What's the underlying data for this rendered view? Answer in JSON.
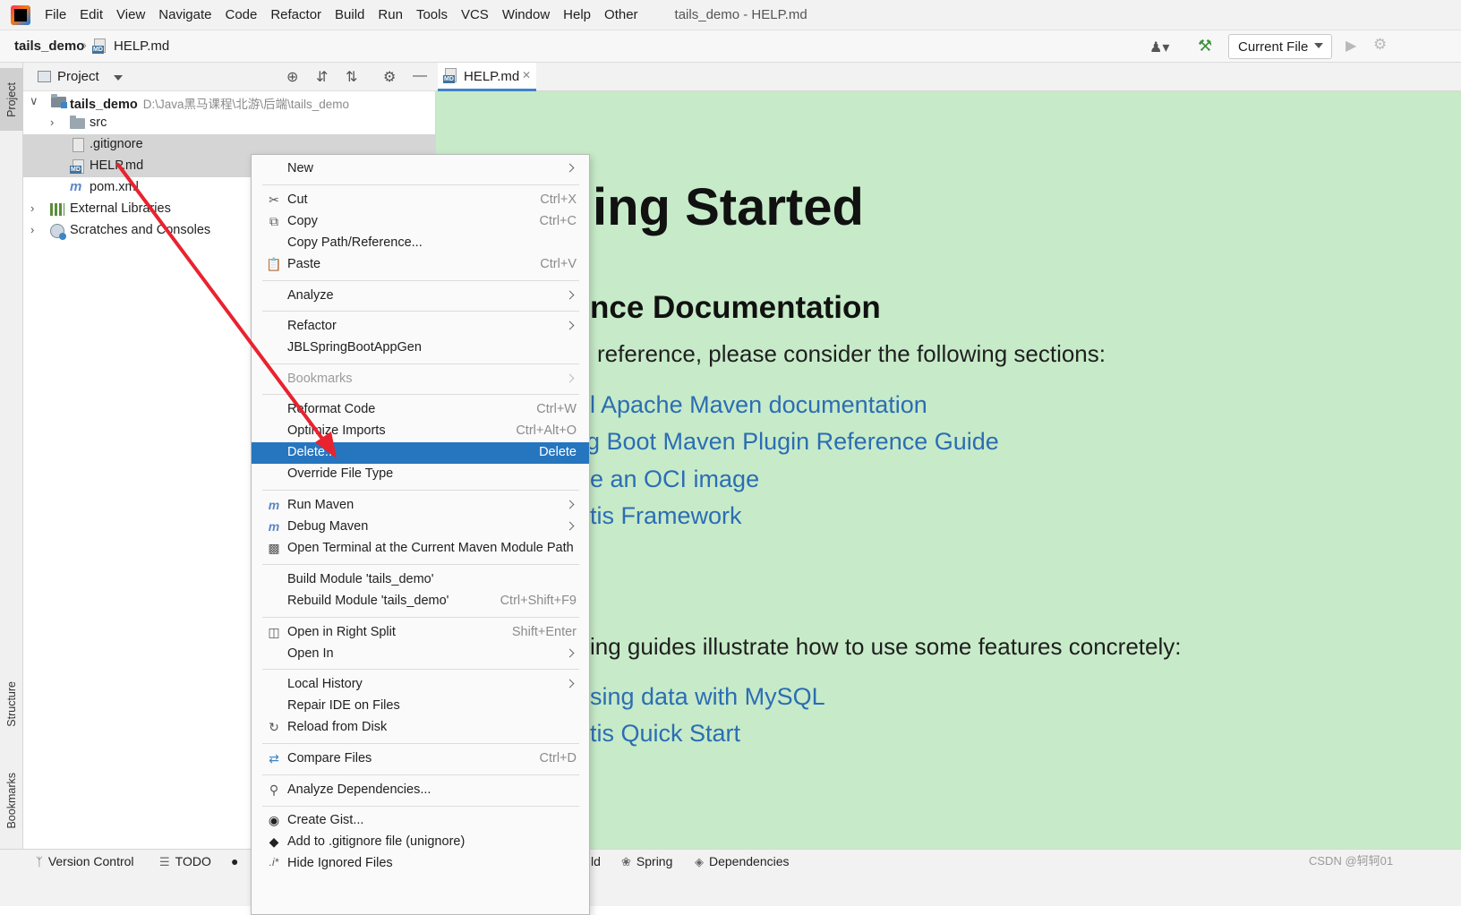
{
  "menubar": {
    "items": [
      "File",
      "Edit",
      "View",
      "Navigate",
      "Code",
      "Refactor",
      "Build",
      "Run",
      "Tools",
      "VCS",
      "Window",
      "Help",
      "Other"
    ],
    "window_title": "tails_demo - HELP.md"
  },
  "navbar": {
    "project": "tails_demo",
    "file": "HELP.md",
    "run_config": "Current File"
  },
  "left_strip": {
    "project_tab": "Project",
    "structure_tab": "Structure",
    "bookmarks_tab": "Bookmarks"
  },
  "project_panel": {
    "title": "Project",
    "tree": [
      {
        "label": "tails_demo",
        "path": "D:\\Java黑马课程\\北游\\后端\\tails_demo"
      },
      {
        "label": "src"
      },
      {
        "label": ".gitignore"
      },
      {
        "label": "HELP.md"
      },
      {
        "label": "pom.xml"
      },
      {
        "label": "External Libraries"
      },
      {
        "label": "Scratches and Consoles"
      }
    ]
  },
  "editor": {
    "tab": "HELP.md",
    "md_badge": "MD",
    "content": {
      "h1": "ing Started",
      "h2_ref": "nce Documentation",
      "p_ref": "reference, please consider the following sections:",
      "links1": [
        "l Apache Maven documentation",
        "g Boot Maven Plugin Reference Guide",
        "e an OCI image",
        "tis Framework"
      ],
      "p_guides": "ing guides illustrate how to use some features concretely:",
      "links2": [
        "sing data with MySQL",
        "tis Quick Start"
      ]
    }
  },
  "context_menu": {
    "items": [
      {
        "label": "New",
        "shortcut": ""
      },
      {
        "label": "Cut",
        "shortcut": "Ctrl+X"
      },
      {
        "label": "Copy",
        "shortcut": "Ctrl+C"
      },
      {
        "label": "Copy Path/Reference...",
        "shortcut": ""
      },
      {
        "label": "Paste",
        "shortcut": "Ctrl+V"
      },
      {
        "label": "Analyze",
        "shortcut": ""
      },
      {
        "label": "Refactor",
        "shortcut": ""
      },
      {
        "label": "JBLSpringBootAppGen",
        "shortcut": ""
      },
      {
        "label": "Bookmarks",
        "shortcut": ""
      },
      {
        "label": "Reformat Code",
        "shortcut": "Ctrl+W"
      },
      {
        "label": "Optimize Imports",
        "shortcut": "Ctrl+Alt+O"
      },
      {
        "label": "Delete...",
        "shortcut": "Delete"
      },
      {
        "label": "Override File Type",
        "shortcut": ""
      },
      {
        "label": "Run Maven",
        "shortcut": ""
      },
      {
        "label": "Debug Maven",
        "shortcut": ""
      },
      {
        "label": "Open Terminal at the Current Maven Module Path",
        "shortcut": ""
      },
      {
        "label": "Build Module 'tails_demo'",
        "shortcut": ""
      },
      {
        "label": "Rebuild Module 'tails_demo'",
        "shortcut": "Ctrl+Shift+F9"
      },
      {
        "label": "Open in Right Split",
        "shortcut": "Shift+Enter"
      },
      {
        "label": "Open In",
        "shortcut": ""
      },
      {
        "label": "Local History",
        "shortcut": ""
      },
      {
        "label": "Repair IDE on Files",
        "shortcut": ""
      },
      {
        "label": "Reload from Disk",
        "shortcut": ""
      },
      {
        "label": "Compare Files",
        "shortcut": "Ctrl+D"
      },
      {
        "label": "Analyze Dependencies...",
        "shortcut": ""
      },
      {
        "label": "Create Gist...",
        "shortcut": ""
      },
      {
        "label": "Add to .gitignore file (unignore)",
        "shortcut": ""
      },
      {
        "label": "Hide Ignored Files",
        "shortcut": ""
      }
    ]
  },
  "statusbar": {
    "version_control": "Version Control",
    "todo": "TODO",
    "build_fragment": "ld",
    "spring": "Spring",
    "dependencies": "Dependencies",
    "watermark": "CSDN @轲轲01"
  },
  "colors": {
    "selection": "#2675bf",
    "editor_background": "#c7ebc8",
    "link": "#2c6db4",
    "annotation": "#e8232f"
  }
}
